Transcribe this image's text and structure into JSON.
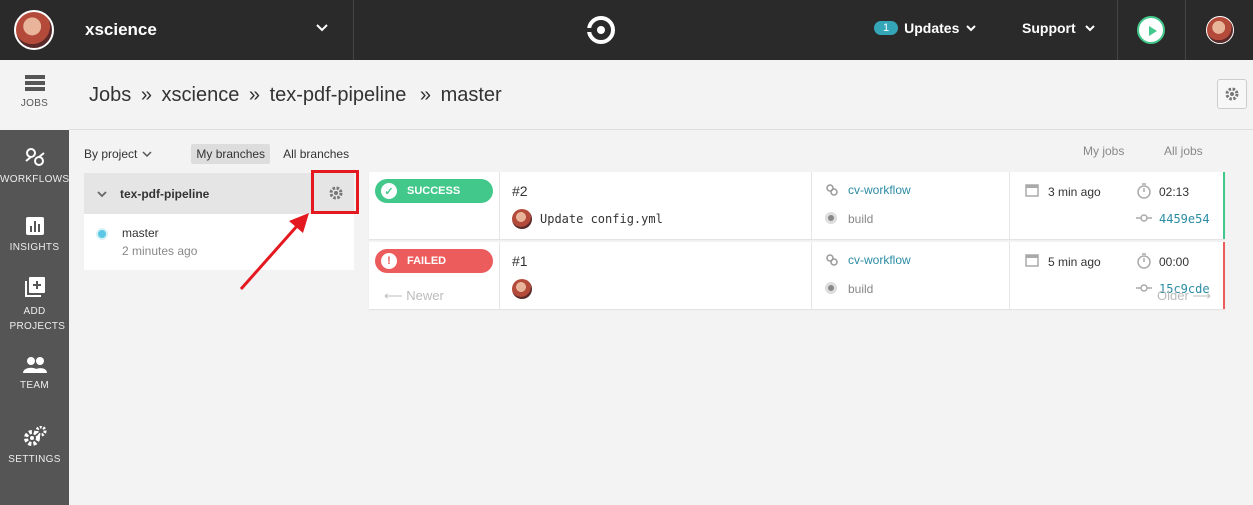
{
  "topbar": {
    "org_name": "xscience",
    "updates_count": "1",
    "updates_label": "Updates",
    "support_label": "Support"
  },
  "sidebar": {
    "items": [
      {
        "label": "JOBS",
        "icon": "jobs-icon"
      },
      {
        "label": "WORKFLOWS",
        "icon": "workflows-icon"
      },
      {
        "label": "INSIGHTS",
        "icon": "insights-icon"
      },
      {
        "label": "ADD PROJECTS",
        "icon": "add-projects-icon"
      },
      {
        "label": "TEAM",
        "icon": "team-icon"
      },
      {
        "label": "SETTINGS",
        "icon": "settings-icon"
      }
    ]
  },
  "breadcrumb": {
    "root": "Jobs",
    "sep": "»",
    "org": "xscience",
    "project": "tex-pdf-pipeline",
    "branch": "master"
  },
  "filters": {
    "by_project": "By project",
    "my_branches": "My branches",
    "all_branches": "All branches",
    "my_jobs": "My jobs",
    "all_jobs": "All jobs"
  },
  "project_panel": {
    "project_name": "tex-pdf-pipeline",
    "branch_name": "master",
    "branch_time": "2 minutes ago"
  },
  "jobs": [
    {
      "status": "SUCCESS",
      "number": "#2",
      "commit_message": "Update config.yml",
      "workflow": "cv-workflow",
      "job": "build",
      "time_ago": "3 min ago",
      "duration": "02:13",
      "sha": "4459e54"
    },
    {
      "status": "FAILED",
      "number": "#1",
      "commit_message": "",
      "workflow": "cv-workflow",
      "job": "build",
      "time_ago": "5 min ago",
      "duration": "00:00",
      "sha": "15c9cde"
    }
  ],
  "pager": {
    "newer": "⟵ Newer",
    "older": "Older ⟶"
  },
  "colors": {
    "success": "#42c88a",
    "failed": "#ed5c5c",
    "accent": "#2b8ca3",
    "highlight": "#e3191f"
  }
}
